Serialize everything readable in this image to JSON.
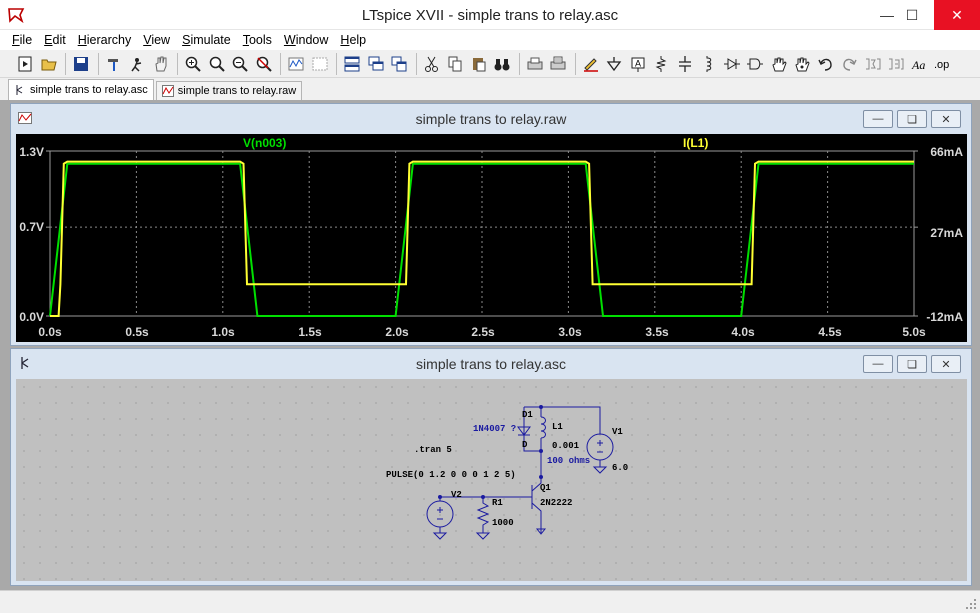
{
  "window": {
    "title": "LTspice XVII - simple trans to relay.asc"
  },
  "menu": [
    {
      "key": "F",
      "rest": "ile"
    },
    {
      "key": "E",
      "rest": "dit"
    },
    {
      "key": "H",
      "rest": "ierarchy"
    },
    {
      "key": "V",
      "rest": "iew"
    },
    {
      "key": "S",
      "rest": "imulate"
    },
    {
      "key": "T",
      "rest": "ools"
    },
    {
      "key": "W",
      "rest": "indow"
    },
    {
      "key": "H",
      "rest": "elp"
    }
  ],
  "tabs": [
    {
      "label": "simple trans to relay.asc",
      "active": true
    },
    {
      "label": "simple trans to relay.raw",
      "active": false
    }
  ],
  "waveform_window": {
    "title": "simple trans to relay.raw",
    "trace_left_label": "V(n003)",
    "trace_right_label": "I(L1)",
    "left_axis_ticks": [
      "1.3V",
      "0.7V",
      "0.0V"
    ],
    "right_axis_ticks": [
      "66mA",
      "27mA",
      "-12mA"
    ],
    "x_axis_ticks": [
      "0.0s",
      "0.5s",
      "1.0s",
      "1.5s",
      "2.0s",
      "2.5s",
      "3.0s",
      "3.5s",
      "4.0s",
      "4.5s",
      "5.0s"
    ],
    "trace_colors": {
      "voltage": "#00e000",
      "current": "#ffff33"
    }
  },
  "chart_data": {
    "type": "line",
    "x_range": [
      0,
      5
    ],
    "left_range": [
      0,
      1.3
    ],
    "right_range": [
      -12,
      66
    ],
    "grid": true,
    "series": [
      {
        "name": "V(n003)",
        "axis": "left",
        "x": [
          0,
          0.1,
          1.1,
          1.2,
          2.0,
          2.1,
          3.1,
          3.2,
          4.0,
          4.1,
          5.0
        ],
        "y": [
          0,
          1.2,
          1.2,
          0,
          0,
          1.2,
          1.2,
          0,
          0,
          1.2,
          1.2
        ]
      },
      {
        "name": "I(L1)",
        "axis": "right",
        "x": [
          0,
          0.05,
          0.06,
          0.08,
          0.1,
          1.1,
          1.12,
          1.14,
          2.04,
          2.06,
          2.08,
          2.1,
          3.1,
          3.12,
          3.14,
          4.04,
          4.06,
          4.08,
          4.1,
          5.0
        ],
        "y": [
          -12,
          -12,
          3,
          60,
          61,
          61,
          60,
          3,
          3,
          3,
          60,
          61,
          61,
          60,
          3,
          3,
          3,
          60,
          61,
          61
        ]
      }
    ]
  },
  "schematic_window": {
    "title": "simple trans to relay.asc",
    "directive": ".tran 5",
    "pulse": "PULSE(0 1.2 0 0 0 1 2 5)",
    "d1_name": "D1",
    "d1_model": "1N4007 ?",
    "d1_pin": "D",
    "l1_name": "L1",
    "l1_value": "0.001",
    "l1_rser": "100 ohms",
    "v1_name": "V1",
    "v1_value": "6.0",
    "v2_name": "V2",
    "r1_name": "R1",
    "r1_value": "1000",
    "q1_name": "Q1",
    "q1_model": "2N2222"
  }
}
